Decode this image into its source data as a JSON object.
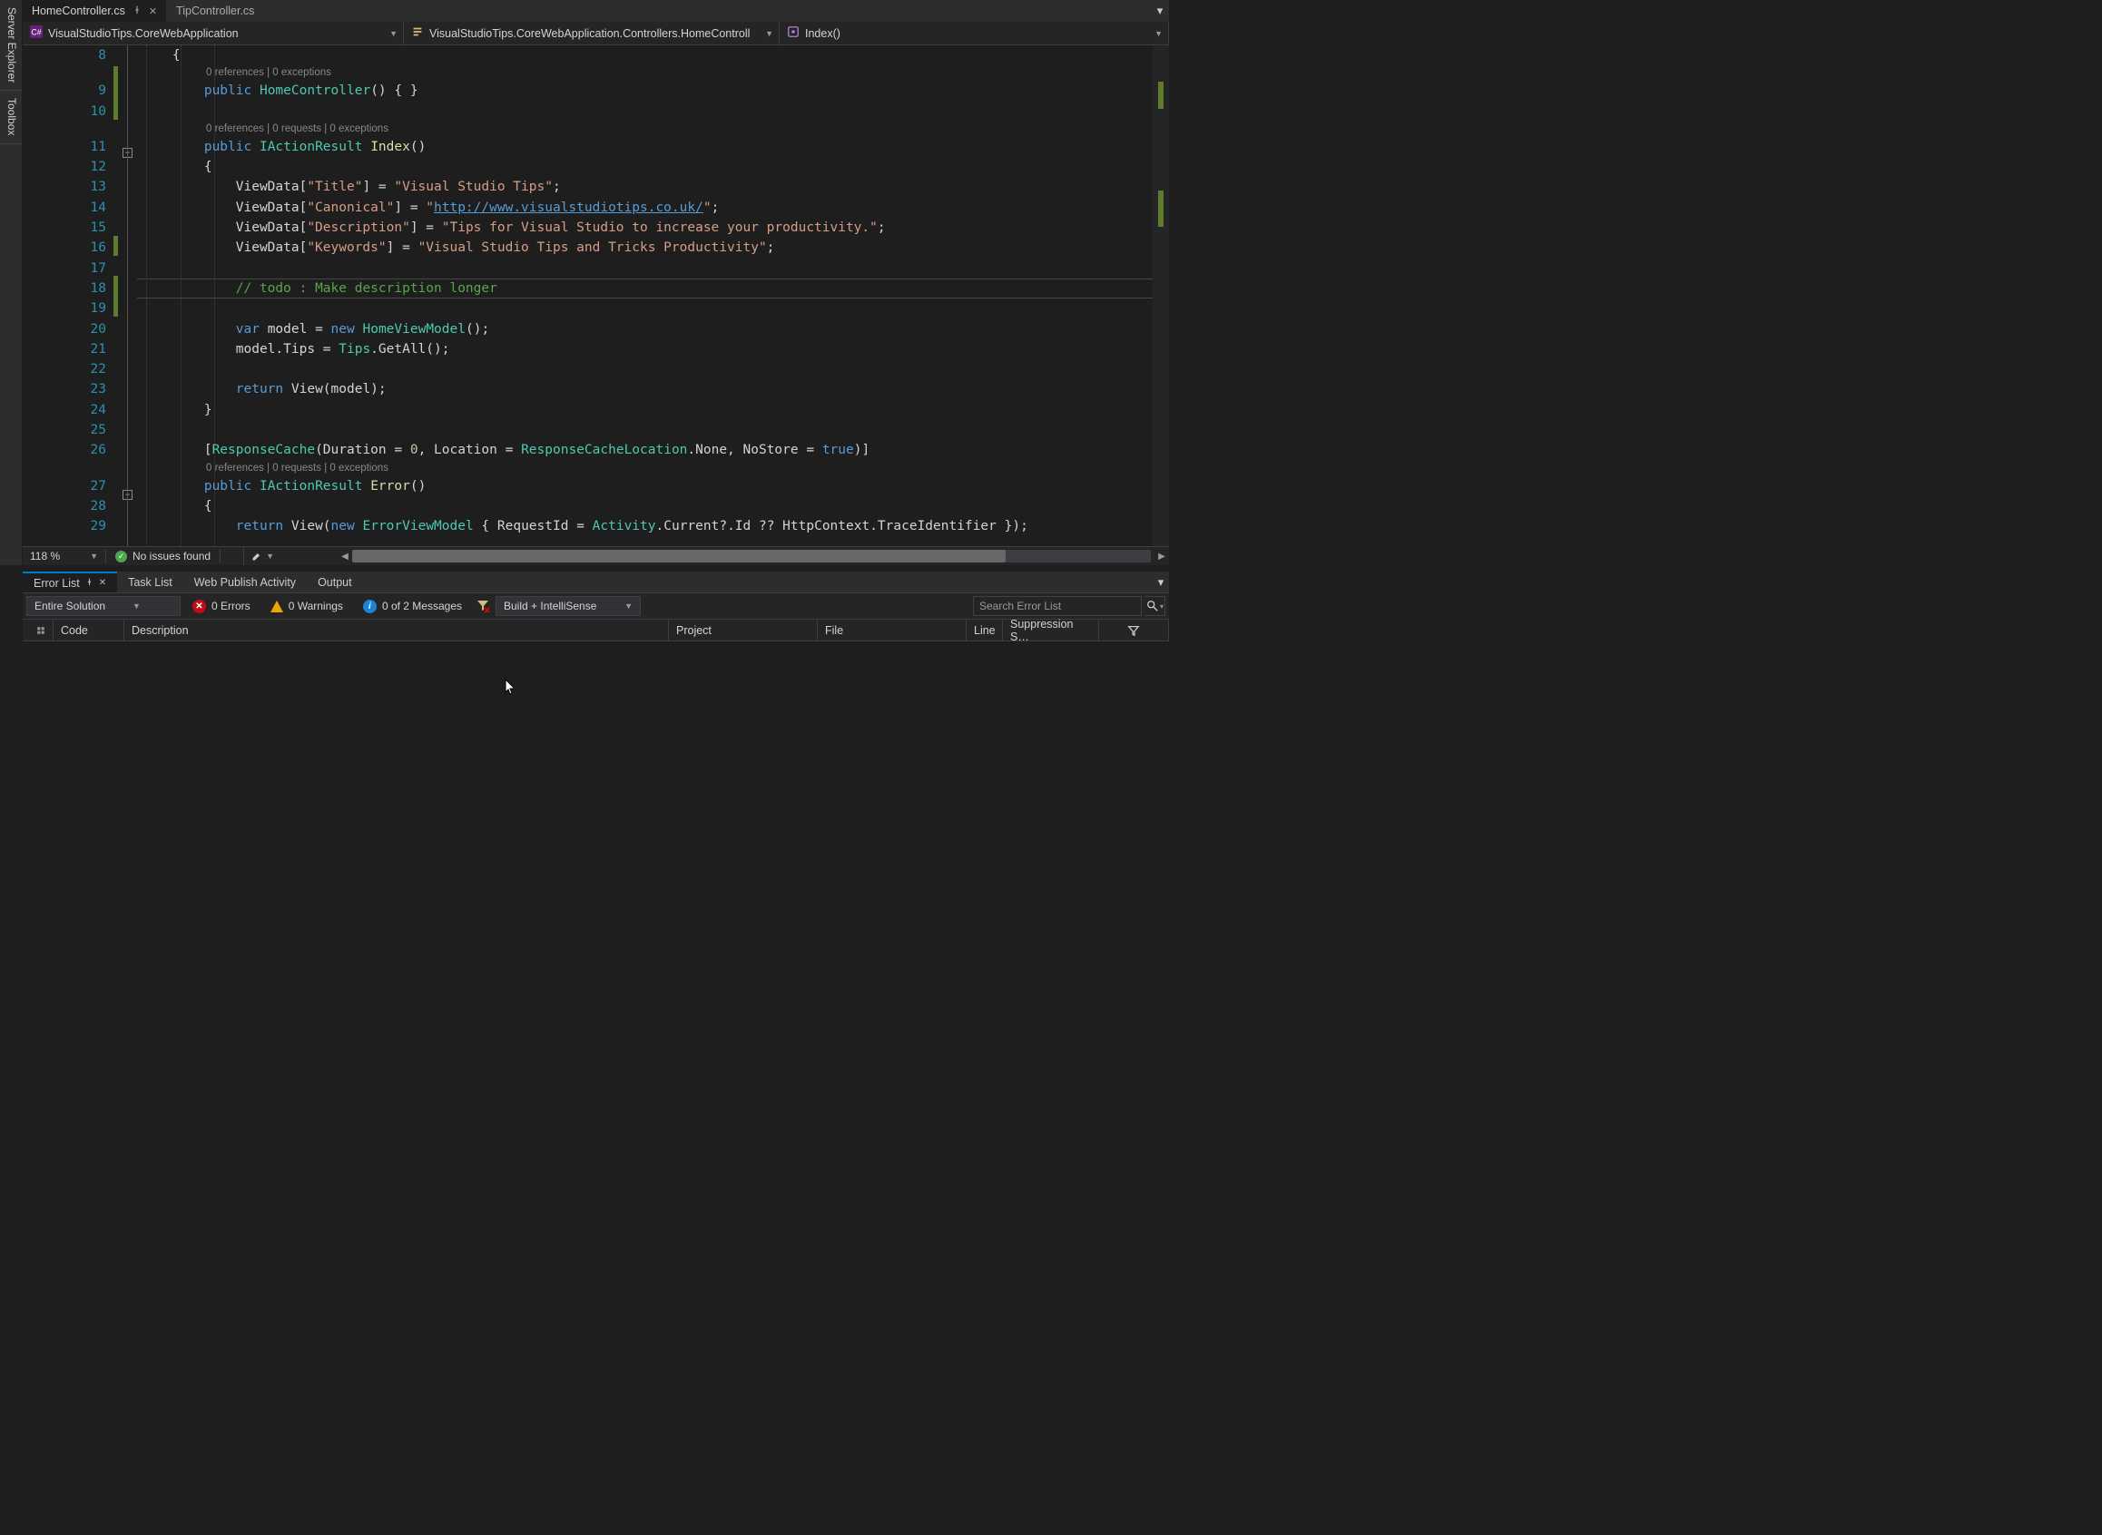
{
  "sideTabs": {
    "serverExplorer": "Server Explorer",
    "toolbox": "Toolbox"
  },
  "docTabs": {
    "active": "HomeController.cs",
    "other": "TipController.cs"
  },
  "nav": {
    "namespace": "VisualStudioTips.CoreWebApplication",
    "class": "VisualStudioTips.CoreWebApplication.Controllers.HomeControll",
    "member": "Index()"
  },
  "lineNumbers": [
    "8",
    "9",
    "10",
    "11",
    "12",
    "13",
    "14",
    "15",
    "16",
    "17",
    "18",
    "19",
    "20",
    "21",
    "22",
    "23",
    "24",
    "25",
    "26",
    "27",
    "28",
    "29"
  ],
  "codelens": {
    "ctor": "0 references | 0 exceptions",
    "index": "0 references | 0 requests | 0 exceptions",
    "error": "0 references | 0 requests | 0 exceptions"
  },
  "code": {
    "indexUrl": "http://www.visualstudiotips.co.uk/",
    "todo": "// todo : Make description longer"
  },
  "status": {
    "zoom": "118 %",
    "issues": "No issues found"
  },
  "panelTabs": {
    "errorList": "Error List",
    "taskList": "Task List",
    "webPublish": "Web Publish Activity",
    "output": "Output"
  },
  "errorToolbar": {
    "scope": "Entire Solution",
    "errors": "0 Errors",
    "warnings": "0 Warnings",
    "messages": "0 of 2 Messages",
    "buildCombo": "Build + IntelliSense",
    "searchPlaceholder": "Search Error List"
  },
  "errorHeaders": {
    "code": "Code",
    "description": "Description",
    "project": "Project",
    "file": "File",
    "line": "Line",
    "suppression": "Suppression S…"
  }
}
